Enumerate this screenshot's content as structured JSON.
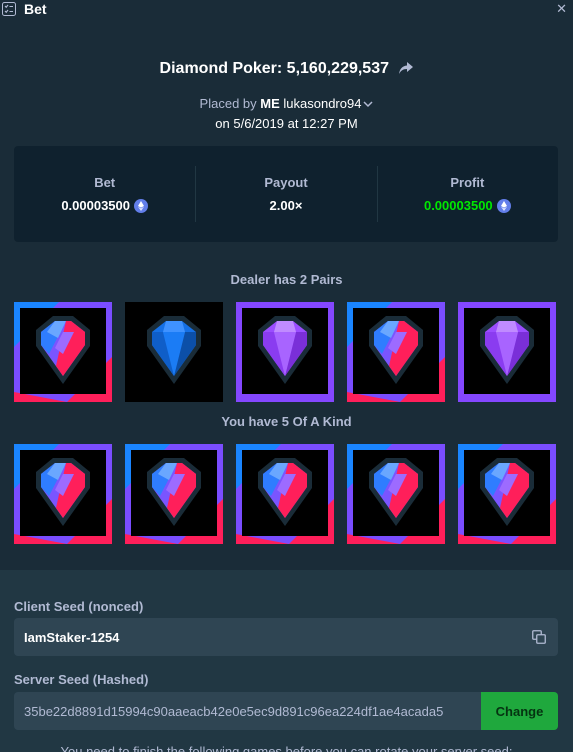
{
  "window": {
    "title": "Bet"
  },
  "header": {
    "game_title": "Diamond Poker: 5,160,229,537",
    "placed_by_prefix": "Placed by",
    "placed_by_badge": "ME",
    "username": "lukasondro94",
    "date": "on 5/6/2019 at 12:27 PM"
  },
  "stats": {
    "bet_label": "Bet",
    "bet_value": "0.00003500",
    "payout_label": "Payout",
    "payout_value": "2.00×",
    "profit_label": "Profit",
    "profit_value": "0.00003500"
  },
  "dealer": {
    "label": "Dealer has 2 Pairs",
    "cards": [
      "split-red-blue",
      "blue",
      "purple",
      "split-red-blue",
      "purple"
    ]
  },
  "player": {
    "label": "You have 5 Of A Kind",
    "cards": [
      "split-red-blue",
      "split-red-blue",
      "split-red-blue",
      "split-red-blue",
      "split-red-blue"
    ]
  },
  "seeds": {
    "client_label": "Client Seed (nonced)",
    "client_value": "IamStaker-1254",
    "server_label": "Server Seed (Hashed)",
    "server_value": "35be22d8891d15994c90aaeacb42e0e5ec9d891c96ea224df1ae4acada5",
    "change_label": "Change",
    "note": "You need to finish the following games before you can rotate your server seed:"
  },
  "colors": {
    "background": "#1a2c38",
    "panel": "#0f212e",
    "profit": "#00e701",
    "button": "#1fa83d"
  },
  "icons": {
    "menu": "checklist-icon",
    "close": "close-icon",
    "share": "share-arrow-icon",
    "currency": "ethereum-icon",
    "copy": "copy-icon"
  }
}
